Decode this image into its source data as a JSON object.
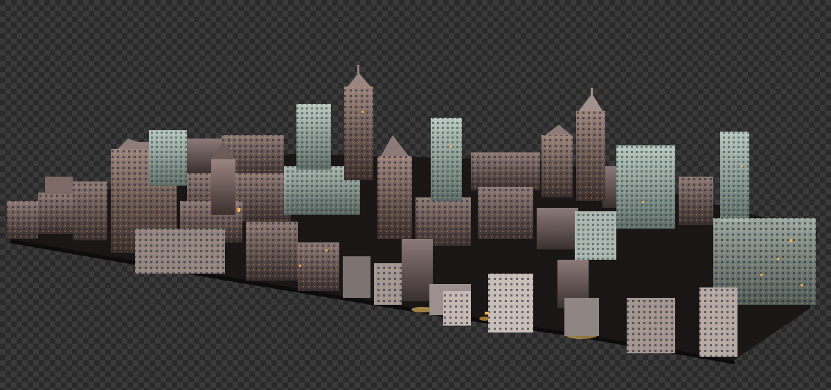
{
  "scene": {
    "background": "transparency-checkerboard",
    "subject": "procedural-city-render",
    "palette": {
      "checker_dark": "#2a2a2a",
      "checker_light": "#3a3a3a",
      "ground": "#1a1616",
      "building_warm": "#6e5a55",
      "building_cool": "#9fb2ae",
      "window_glow": "#ffb347",
      "street_light": "#ffcf6b"
    }
  }
}
